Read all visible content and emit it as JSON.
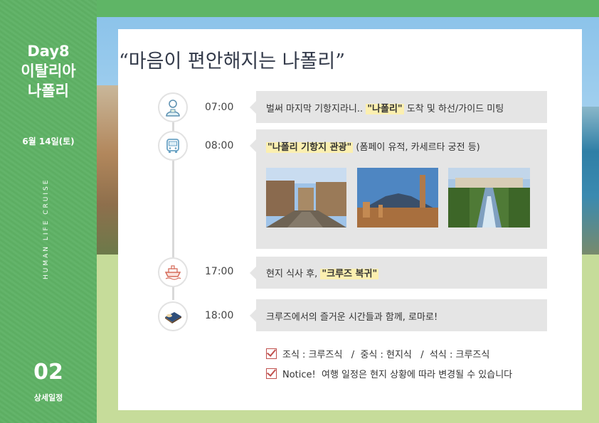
{
  "sidebar": {
    "day": "Day8",
    "country": "이탈리아",
    "city": "나폴리",
    "date": "6월 14일(토)",
    "vertical": "HUMAN LIFE CRUISE",
    "section_number": "02",
    "section_label": "상세일정"
  },
  "title": "“마음이 편안해지는 나폴리”",
  "schedule": [
    {
      "time": "07:00",
      "icon": "guide-icon",
      "text_pre": "벌써 마지막 기항지라니.. ",
      "highlight": "\"나폴리\"",
      "text_post": " 도착 및 하선/가이드 미팅"
    },
    {
      "time": "08:00",
      "icon": "bus-icon",
      "text_pre": "",
      "highlight": "\"나폴리 기항지 관광\"",
      "text_post": " (폼페이 유적, 카세르타 궁전 등)"
    },
    {
      "time": "17:00",
      "icon": "cruise-ship-icon",
      "text_pre": "현지 식사 후, ",
      "highlight": "\"크루즈 복귀\"",
      "text_post": ""
    },
    {
      "time": "18:00",
      "icon": "bed-icon",
      "text_pre": "크루즈에서의 즐거운 시간들과 함께, 로마로!",
      "highlight": "",
      "text_post": ""
    }
  ],
  "photos": [
    "pompeii-street-photo",
    "pompeii-vesuvius-photo",
    "caserta-palace-photo"
  ],
  "notes": [
    "조식 : 크루즈식   /  중식 : 현지식   /  석식 : 크루즈식",
    "Notice!  여행 일정은 현지 상황에 따라 변경될 수 있습니다"
  ],
  "colors": {
    "sidebar_green": "#5fb566",
    "highlight": "#fbefb0",
    "box_gray": "#e5e5e5",
    "check_red": "#c0504d"
  }
}
